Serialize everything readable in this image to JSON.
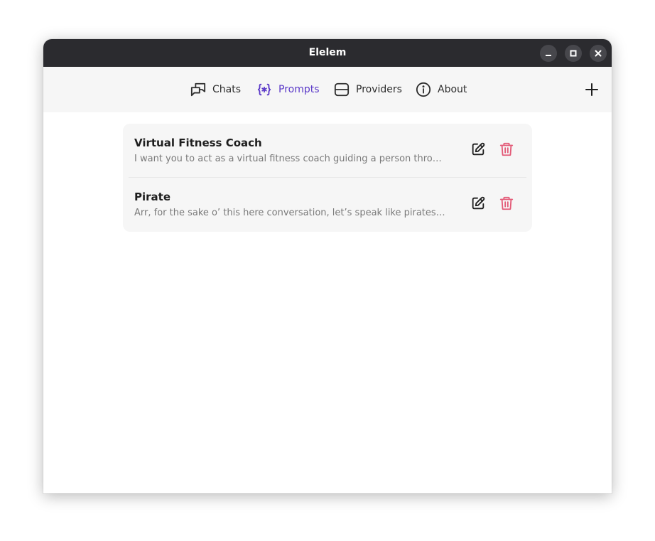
{
  "window": {
    "title": "Elelem"
  },
  "nav": {
    "items": [
      {
        "label": "Chats",
        "icon": "chats-icon"
      },
      {
        "label": "Prompts",
        "icon": "prompts-icon",
        "active": true
      },
      {
        "label": "Providers",
        "icon": "providers-icon"
      },
      {
        "label": "About",
        "icon": "info-icon"
      }
    ],
    "add_icon": "plus-icon"
  },
  "prompts": [
    {
      "title": "Virtual Fitness Coach",
      "preview": "I want you to act as a virtual fitness coach guiding a person through a…"
    },
    {
      "title": "Pirate",
      "preview": "Arr, for the sake o’ this here conversation, let’s speak like pirates, like…"
    }
  ],
  "colors": {
    "accent": "#5a38c8",
    "delete": "#e35a77",
    "titlebar": "#2b2b2f"
  }
}
